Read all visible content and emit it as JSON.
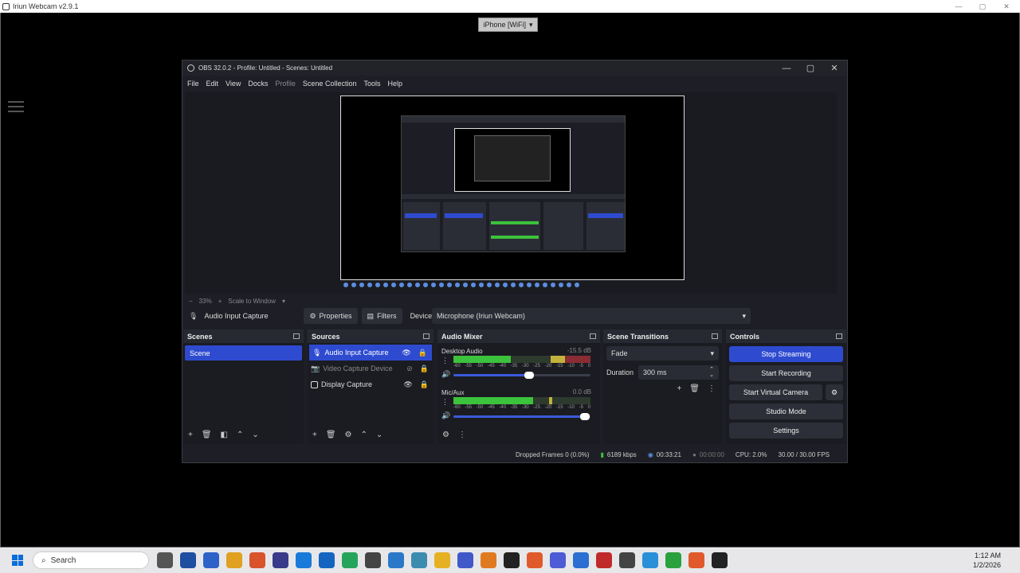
{
  "outer_window": {
    "title": "Iriun Webcam v2.9.1",
    "device_select": "iPhone [WiFi]"
  },
  "obs": {
    "title": "OBS 32.0.2 - Profile: Untitled - Scenes: Untitled",
    "menu": [
      "File",
      "Edit",
      "View",
      "Docks",
      "Profile",
      "Scene Collection",
      "Tools",
      "Help"
    ],
    "zoom": {
      "minus": "−",
      "value": "33%",
      "plus": "+",
      "mode": "Scale to Window"
    },
    "source_toolbar": {
      "source_name": "Audio Input Capture",
      "properties": "Properties",
      "filters": "Filters",
      "device_label": "Device",
      "device_value": "Microphone (Iriun Webcam)"
    },
    "scenes": {
      "title": "Scenes",
      "items": [
        "Scene"
      ]
    },
    "sources": {
      "title": "Sources",
      "items": [
        {
          "label": "Audio Input Capture",
          "selected": true
        },
        {
          "label": "Video Capture Device",
          "selected": false
        },
        {
          "label": "Display Capture",
          "selected": false
        }
      ]
    },
    "mixer": {
      "title": "Audio Mixer",
      "channels": [
        {
          "name": "Desktop Audio",
          "db": "-15.5 dB",
          "volume_fraction": 0.55
        },
        {
          "name": "Mic/Aux",
          "db": "0.0 dB",
          "volume_fraction": 0.96
        }
      ],
      "scale": [
        "-60",
        "-55",
        "-50",
        "-45",
        "-40",
        "-35",
        "-30",
        "-25",
        "-20",
        "-15",
        "-10",
        "-5",
        "0"
      ]
    },
    "transitions": {
      "title": "Scene Transitions",
      "type": "Fade",
      "duration_label": "Duration",
      "duration_value": "300 ms"
    },
    "controls": {
      "title": "Controls",
      "stop_streaming": "Stop Streaming",
      "start_recording": "Start Recording",
      "start_virtual_camera": "Start Virtual Camera",
      "studio_mode": "Studio Mode",
      "settings": "Settings"
    },
    "status": {
      "dropped": "Dropped Frames 0 (0.0%)",
      "bitrate": "6189 kbps",
      "stream_time": "00:33:21",
      "rec_time": "00:00:00",
      "cpu": "CPU: 2.0%",
      "fps": "30.00 / 30.00 FPS"
    }
  },
  "taskbar": {
    "search_placeholder": "Search",
    "time": "1:12 AM",
    "date": "1/2/2026"
  },
  "colors": {
    "accent": "#2e4bd0",
    "meter_green": "#3cc23c",
    "meter_yellow": "#c2b23c",
    "meter_red": "#8b2b33"
  }
}
